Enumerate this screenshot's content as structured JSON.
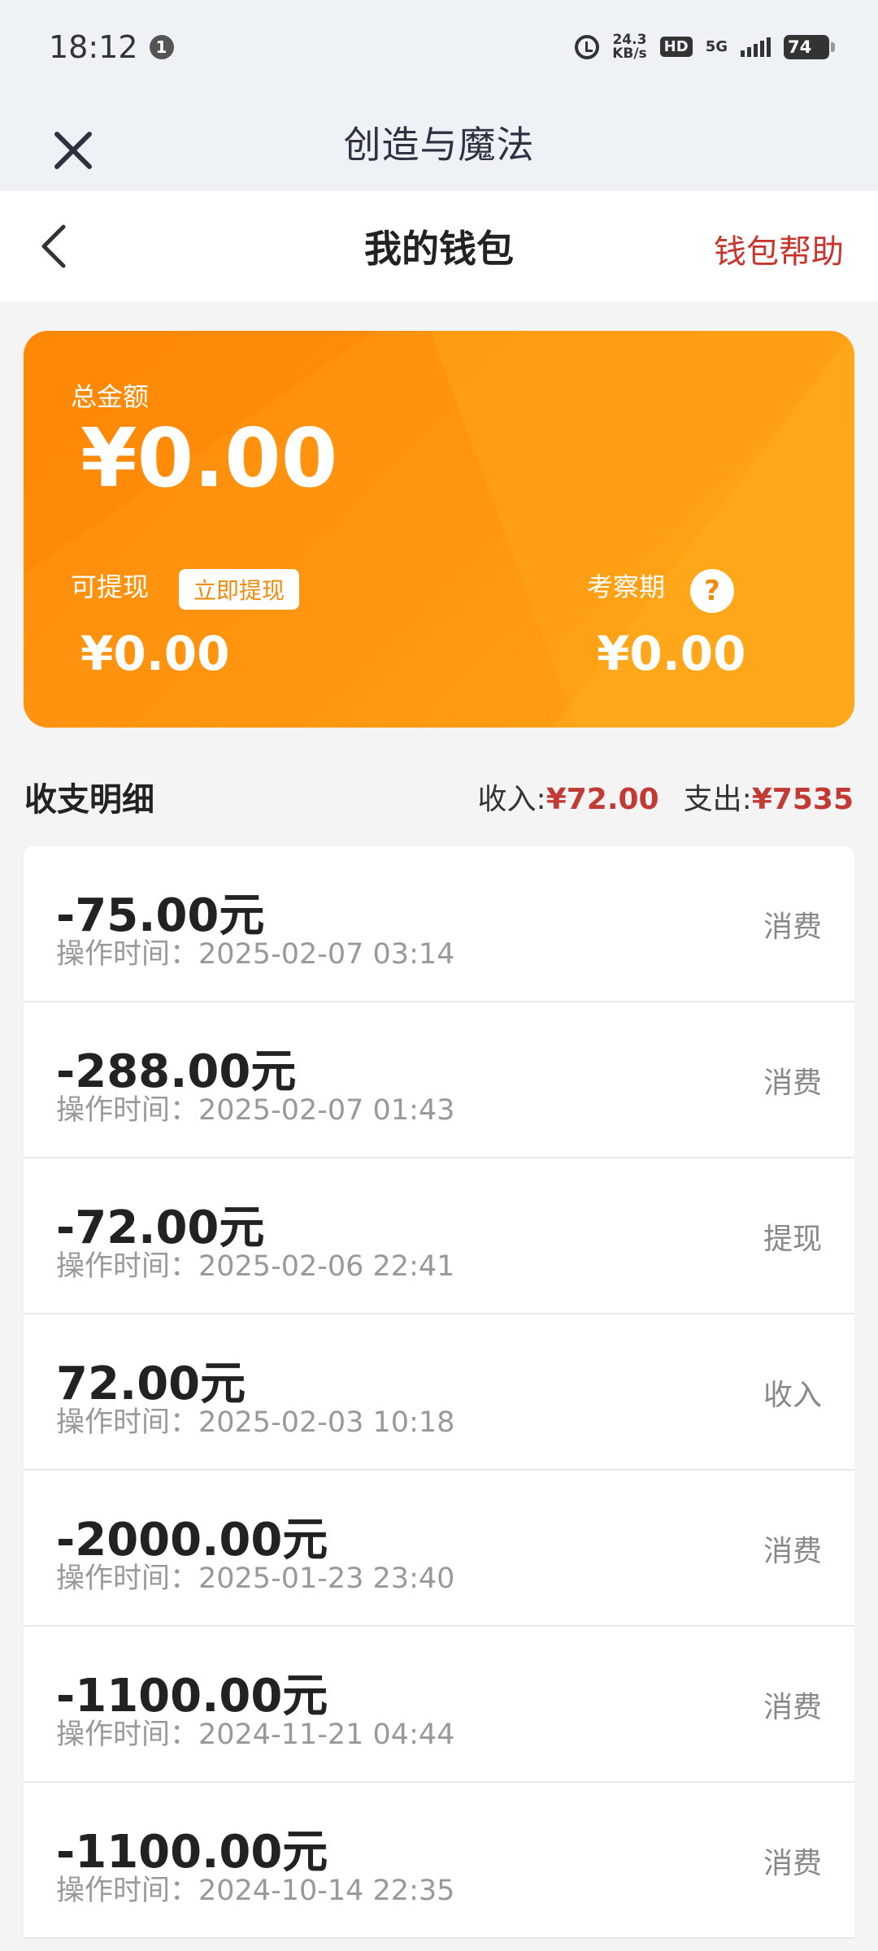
{
  "status_bar": {
    "time": "18:12",
    "notification_count": "1",
    "speed_value": "24.3",
    "speed_unit": "KB/s",
    "hd": "HD",
    "network": "5G",
    "battery": "74"
  },
  "app_bar": {
    "title": "创造与魔法"
  },
  "nav": {
    "title": "我的钱包",
    "help_label": "钱包帮助"
  },
  "wallet": {
    "total_label": "总金额",
    "total_amount": "¥0.00",
    "withdrawable_label": "可提现",
    "withdraw_button": "立即提现",
    "withdrawable_amount": "¥0.00",
    "review_label": "考察期",
    "review_amount": "¥0.00"
  },
  "details": {
    "title": "收支明细",
    "income_label": "收入:",
    "income_value": "¥72.00",
    "expense_label": "支出:",
    "expense_value": "¥7535"
  },
  "transactions": [
    {
      "amount": "-75.00元",
      "time": "操作时间：2025-02-07 03:14",
      "type": "消费"
    },
    {
      "amount": "-288.00元",
      "time": "操作时间：2025-02-07 01:43",
      "type": "消费"
    },
    {
      "amount": "-72.00元",
      "time": "操作时间：2025-02-06 22:41",
      "type": "提现"
    },
    {
      "amount": "72.00元",
      "time": "操作时间：2025-02-03 10:18",
      "type": "收入"
    },
    {
      "amount": "-2000.00元",
      "time": "操作时间：2025-01-23 23:40",
      "type": "消费"
    },
    {
      "amount": "-1100.00元",
      "time": "操作时间：2024-11-21 04:44",
      "type": "消费"
    },
    {
      "amount": "-1100.00元",
      "time": "操作时间：2024-10-14 22:35",
      "type": "消费"
    }
  ],
  "colors": {
    "accent_red": "#c23a33",
    "card_orange": "#ff9510"
  }
}
